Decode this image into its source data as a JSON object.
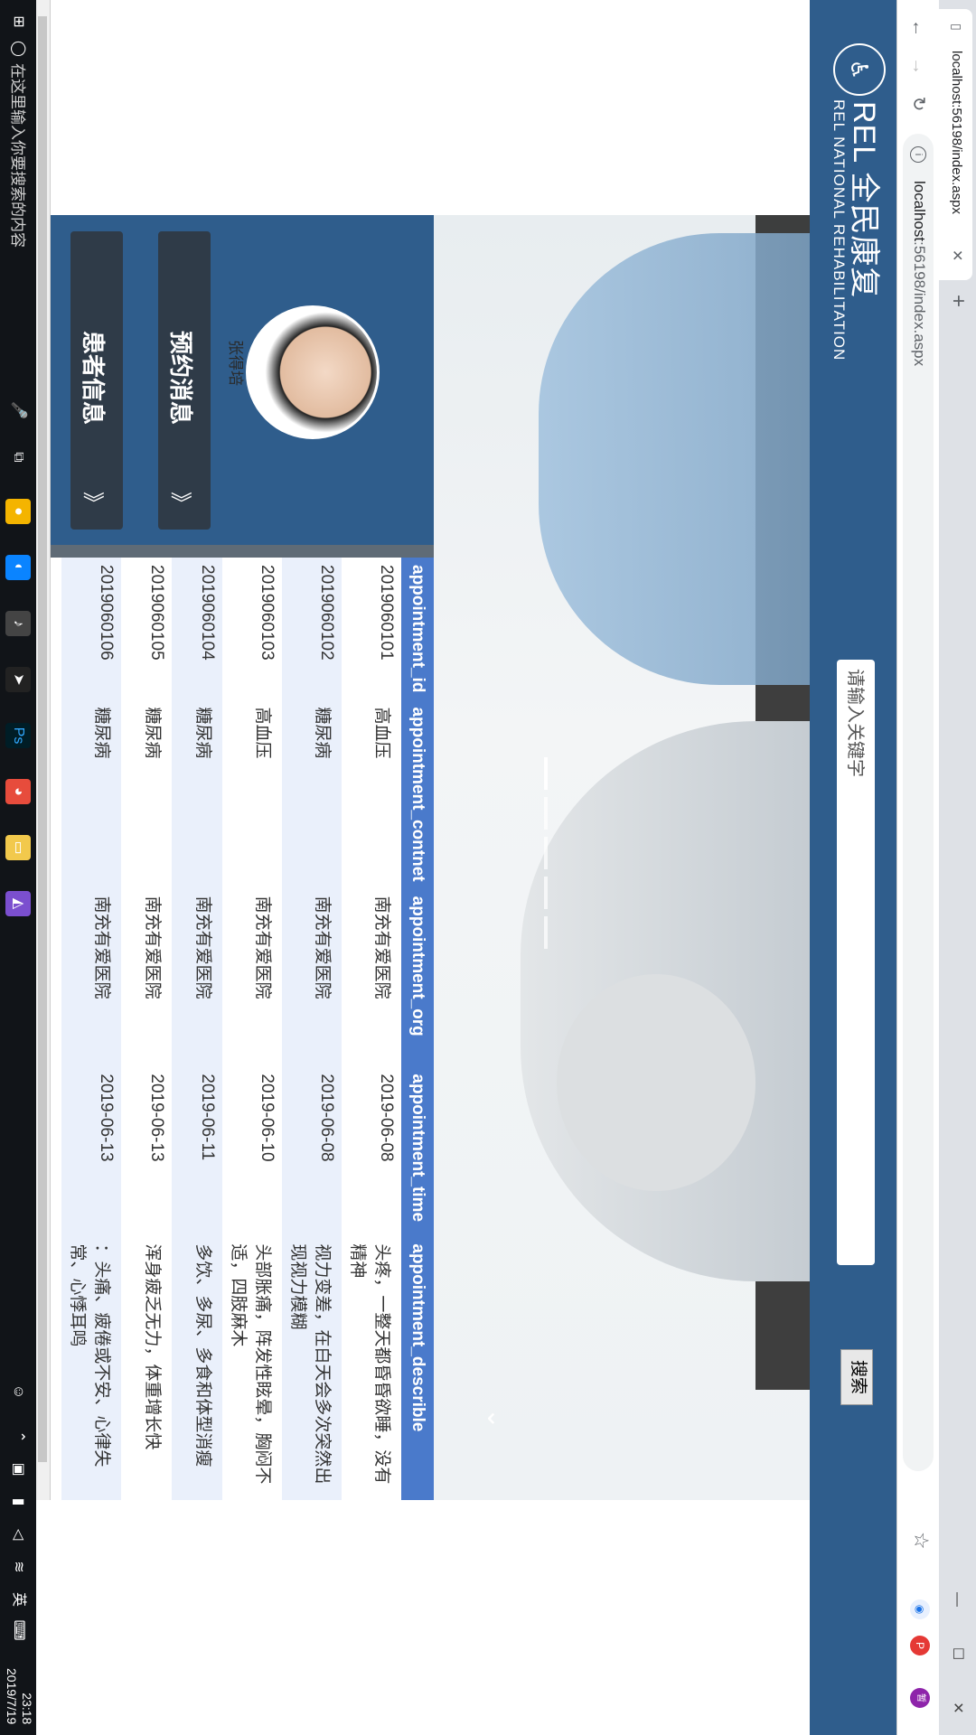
{
  "browser": {
    "tab_title": "localhost:56198/index.aspx",
    "url_host": "localhost",
    "url_rest": ":56198/index.aspx",
    "close_icon": "close-icon",
    "new_tab_label": "+",
    "minimize_label": "—",
    "maximize_label": "☐",
    "winclose_label": "✕"
  },
  "header": {
    "brand_cn": "REL 全民康复",
    "brand_en": "REL NATIONAL REHABILITATION",
    "search_placeholder": "请输入关键字",
    "search_button": "搜索",
    "accent_color": "#2f5d8c"
  },
  "sidebar": {
    "username": "张得培",
    "buttons": [
      {
        "label": "预约消息",
        "chevron": "》"
      },
      {
        "label": "患者信息",
        "chevron": "》"
      }
    ]
  },
  "table": {
    "headers": [
      "appointment_id",
      "appointment_contnet",
      "appointment_org",
      "appointment_time",
      "appointment_describle"
    ],
    "rows": [
      [
        "2019060101",
        "高血压",
        "南充有爱医院",
        "2019-06-08",
        "头疼，一整天都昏昏欲睡，没有精神"
      ],
      [
        "2019060102",
        "糖尿病",
        "南充有爱医院",
        "2019-06-08",
        "视力变差，在白天会多次突然出现视力模糊"
      ],
      [
        "2019060103",
        "高血压",
        "南充有爱医院",
        "2019-06-10",
        "头部胀痛，阵发性眩晕，胸闷不适，四肢麻木"
      ],
      [
        "2019060104",
        "糖尿病",
        "南充有爱医院",
        "2019-06-11",
        "多饮、多尿、多食和体型消瘦"
      ],
      [
        "2019060105",
        "糖尿病",
        "南充有爱医院",
        "2019-06-13",
        "浑身疲乏无力，体重增长快"
      ],
      [
        "2019060106",
        "糖尿病",
        "南充有爱医院",
        "2019-06-13",
        "：头痛、疲倦或不安、心律失常、心悸耳鸣"
      ]
    ]
  },
  "taskbar": {
    "search_placeholder": "在这里输入你要搜索的内容",
    "time": "23:18",
    "date": "2019/7/19",
    "ime": "英"
  }
}
